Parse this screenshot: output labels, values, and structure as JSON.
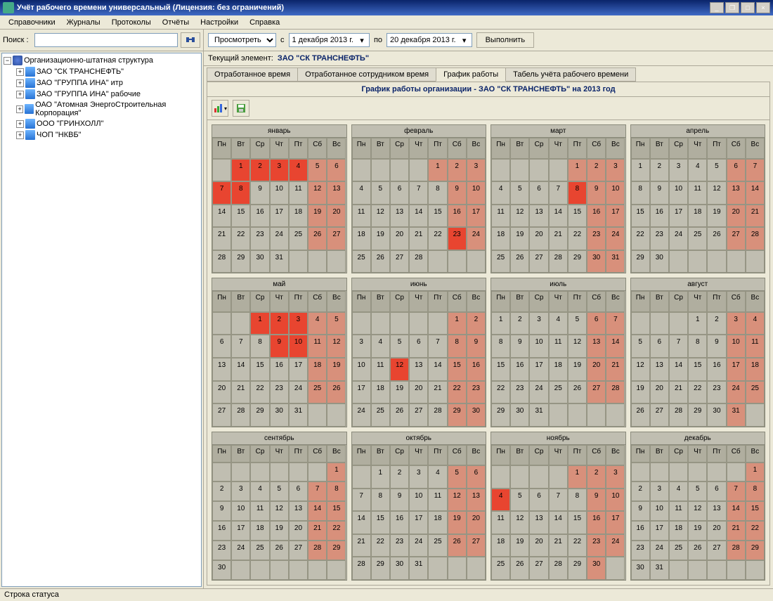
{
  "window": {
    "title": "Учёт рабочего времени универсальный (Лицензия: без ограничений)",
    "min": "_",
    "max": "□",
    "restore": "❐",
    "close": "×"
  },
  "menu": [
    "Справочники",
    "Журналы",
    "Протоколы",
    "Отчёты",
    "Настройки",
    "Справка"
  ],
  "search": {
    "label": "Поиск :",
    "value": ""
  },
  "tree": {
    "root": "Организационно-штатная структура",
    "items": [
      "ЗАО  \"СК ТРАНСНЕФТЬ\"",
      "ЗАО  \"ГРУППА ИНА\" итр",
      "ЗАО  \"ГРУППА ИНА\" рабочие",
      "ОАО \"Атомная ЭнергоСтроительная Корпорация\"",
      "ООО \"ГРИНХОЛЛ\"",
      "ЧОП \"НКВБ\""
    ]
  },
  "filter": {
    "mode": "Просмотреть",
    "from_label": "с",
    "from": "1 декабря 2013 г.",
    "to_label": "по",
    "to": "20 декабря 2013 г.",
    "execute": "Выполнить"
  },
  "current": {
    "label": "Текущий элемент:",
    "value": "ЗАО \"СК ТРАНСНЕФТЬ\""
  },
  "tabs": [
    "Отработанное время",
    "Отработанное сотрудником время",
    "График работы",
    "Табель учёта рабочего времени"
  ],
  "active_tab": 2,
  "cal_title": "График работы организации - ЗАО \"СК ТРАНСНЕФТЬ\" на 2013 год",
  "weekdays": [
    "Пн",
    "Вт",
    "Ср",
    "Чт",
    "Пт",
    "Сб",
    "Вс"
  ],
  "months": [
    {
      "name": "январь",
      "start": 1,
      "days": 31,
      "red": [
        1,
        2,
        3,
        4,
        7,
        8
      ],
      "weekend": [
        5,
        6,
        12,
        13,
        19,
        20,
        26,
        27
      ]
    },
    {
      "name": "февраль",
      "start": 4,
      "days": 28,
      "red": [
        23
      ],
      "weekend": [
        1,
        2,
        3,
        9,
        10,
        16,
        17,
        24
      ]
    },
    {
      "name": "март",
      "start": 4,
      "days": 31,
      "red": [
        8
      ],
      "weekend": [
        1,
        2,
        3,
        9,
        10,
        16,
        17,
        23,
        24,
        30,
        31
      ]
    },
    {
      "name": "апрель",
      "start": 0,
      "days": 30,
      "red": [],
      "weekend": [
        6,
        7,
        13,
        14,
        20,
        21,
        27,
        28
      ]
    },
    {
      "name": "май",
      "start": 2,
      "days": 31,
      "red": [
        1,
        2,
        3,
        9,
        10
      ],
      "weekend": [
        4,
        5,
        11,
        12,
        18,
        19,
        25,
        26
      ]
    },
    {
      "name": "июнь",
      "start": 5,
      "days": 30,
      "red": [
        12
      ],
      "weekend": [
        1,
        2,
        8,
        9,
        15,
        16,
        22,
        23,
        29,
        30
      ]
    },
    {
      "name": "июль",
      "start": 0,
      "days": 31,
      "red": [],
      "weekend": [
        6,
        7,
        13,
        14,
        20,
        21,
        27,
        28
      ]
    },
    {
      "name": "август",
      "start": 3,
      "days": 31,
      "red": [],
      "weekend": [
        3,
        4,
        10,
        11,
        17,
        18,
        24,
        25,
        31
      ]
    },
    {
      "name": "сентябрь",
      "start": 6,
      "days": 30,
      "red": [],
      "weekend": [
        1,
        7,
        8,
        14,
        15,
        21,
        22,
        28,
        29
      ]
    },
    {
      "name": "октябрь",
      "start": 1,
      "days": 31,
      "red": [],
      "weekend": [
        5,
        6,
        12,
        13,
        19,
        20,
        26,
        27
      ]
    },
    {
      "name": "ноябрь",
      "start": 4,
      "days": 30,
      "red": [
        4
      ],
      "weekend": [
        1,
        2,
        3,
        9,
        10,
        16,
        17,
        23,
        24,
        30
      ]
    },
    {
      "name": "декабрь",
      "start": 6,
      "days": 31,
      "red": [],
      "weekend": [
        1,
        7,
        8,
        14,
        15,
        21,
        22,
        28,
        29
      ]
    }
  ],
  "status": "Строка статуса"
}
